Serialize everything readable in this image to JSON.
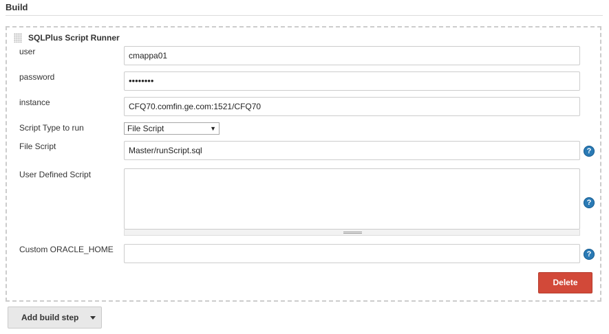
{
  "section": {
    "title": "Build"
  },
  "step": {
    "title": "SQLPlus Script Runner",
    "fields": {
      "user": {
        "label": "user",
        "value": "cmappa01"
      },
      "password": {
        "label": "password",
        "value": "••••••••"
      },
      "instance": {
        "label": "instance",
        "value": "CFQ70.comfin.ge.com:1521/CFQ70"
      },
      "script_type": {
        "label": "Script Type to run",
        "value": "File Script"
      },
      "file_script": {
        "label": "File Script",
        "value": "Master/runScript.sql"
      },
      "user_defined_script": {
        "label": "User Defined Script",
        "value": ""
      },
      "oracle_home": {
        "label": "Custom ORACLE_HOME",
        "value": ""
      }
    },
    "help_glyph": "?",
    "delete_label": "Delete"
  },
  "add_build_step": {
    "label": "Add build step"
  },
  "icons": {
    "help": "help-circle-icon",
    "drag": "drag-handle-icon",
    "dropdown": "caret-down-icon"
  },
  "colors": {
    "delete": "#d24939",
    "help": "#2a7ab5",
    "border": "#cccccc"
  }
}
